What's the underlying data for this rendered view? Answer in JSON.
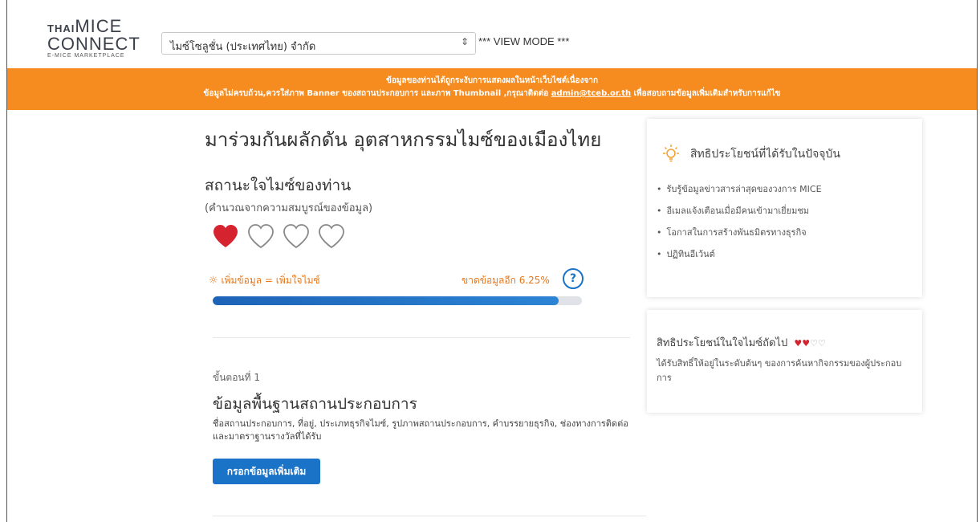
{
  "header": {
    "logo": {
      "line1": "THAI",
      "line1b": "MICE",
      "line2": "CONNECT",
      "line3": "E-MICE MARKETPLACE"
    },
    "company_select": {
      "value": "ไมซ์โซลูชั่น (ประเทศไทย) จำกัด"
    },
    "view_mode": "*** VIEW MODE ***"
  },
  "banner": {
    "line1": "ข้อมูลของท่านได้ถูกระงับการแสดงผลในหน้าเว็บไซต์เนื่องจาก",
    "line2_prefix": "ข้อมูลไม่ครบถ้วน,ควรใส่ภาพ Banner ของสถานประกอบการ และภาพ Thumbnail ,กรุณาติดต่อ ",
    "email": "admin@tceb.or.th",
    "line2_suffix": " เพื่อสอบถามข้อมูลเพิ่มเติมสำหรับการแก้ไข"
  },
  "main": {
    "title": "มาร่วมกันผลักดัน อุตสาหกรรมไมซ์ของเมืองไทย",
    "status_title": "สถานะใจไมซ์ของท่าน",
    "status_subtitle": "(คำนวณจากความสมบูรณ์ของข้อมูล)",
    "hearts_filled": 1,
    "hearts_total": 4,
    "tip": "เพิ่มข้อมูล = เพิ่มใจไมซ์",
    "missing": "ขาดข้อมูลอีก 6.25%",
    "help_icon": "?",
    "progress_percent": 93.75,
    "step": {
      "number": "ขั้นตอนที่ 1",
      "title": "ข้อมูลพื้นฐานสถานประกอบการ",
      "description": "ชื่อสถานประกอบการ, ที่อยู่, ประเภทธุรกิจไมซ์, รูปภาพสถานประกอบการ, คำบรรยายธุรกิจ, ช่องทางการติดต่อ และมาตราฐานรางวัลที่ได้รับ",
      "button": "กรอกข้อมูลเพิ่มเติม"
    }
  },
  "sidebar": {
    "current_benefits": {
      "title": "สิทธิประโยชน์ที่ได้รับในปัจจุบัน",
      "items": [
        "รับรู้ข้อมูลข่าวสารล่าสุดของวงการ MICE",
        "อีเมลแจ้งเตือนเมื่อมีคนเข้ามาเยี่ยมชม",
        "โอกาสในการสร้างพันธมิตรทางธุรกิจ",
        "ปฏิทินอีเว้นต์"
      ]
    },
    "next_benefits": {
      "title": "สิทธิประโยชน์ในใจไมซ์ถัดไป",
      "hearts_filled": "♥♥",
      "hearts_empty": "♡♡",
      "description": "ได้รับสิทธิ์ให้อยู่ในระดับต้นๆ ของการค้นหากิจกรรมของผู้ประกอบการ"
    }
  },
  "colors": {
    "accent": "#f68b1f",
    "primary": "#1a73c7",
    "heart": "#d5232f"
  }
}
